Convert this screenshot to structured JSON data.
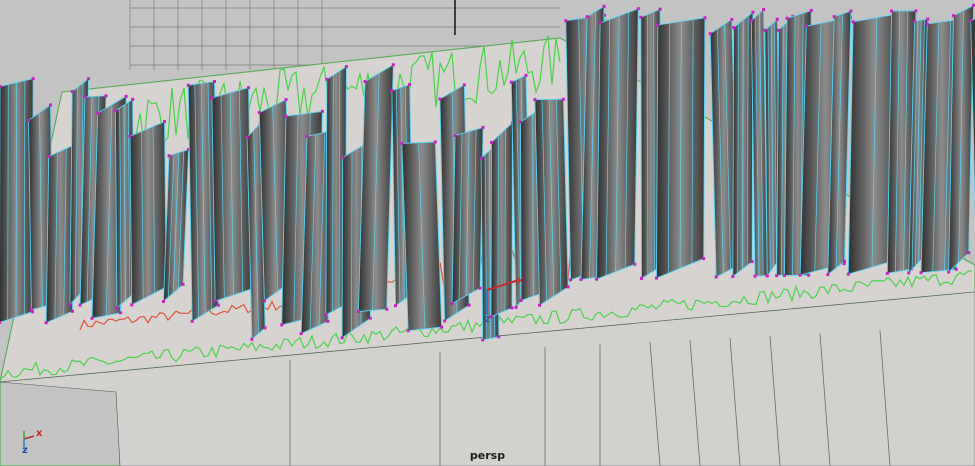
{
  "viewport": {
    "camera_label": "persp",
    "view_cube_labels": {
      "x": "X",
      "z": "Z"
    },
    "manipulator_label": "z"
  },
  "axis_gizmo": {
    "x": "x",
    "z": "z"
  },
  "colors": {
    "background": "#c3c3c3",
    "grid": "#7c7c7c",
    "plane": "#d6d3d0",
    "wire": "#59d4f5",
    "vertex": "#c81ec8",
    "green_curve": "#4ad14a",
    "red_curve": "#e0523a"
  }
}
